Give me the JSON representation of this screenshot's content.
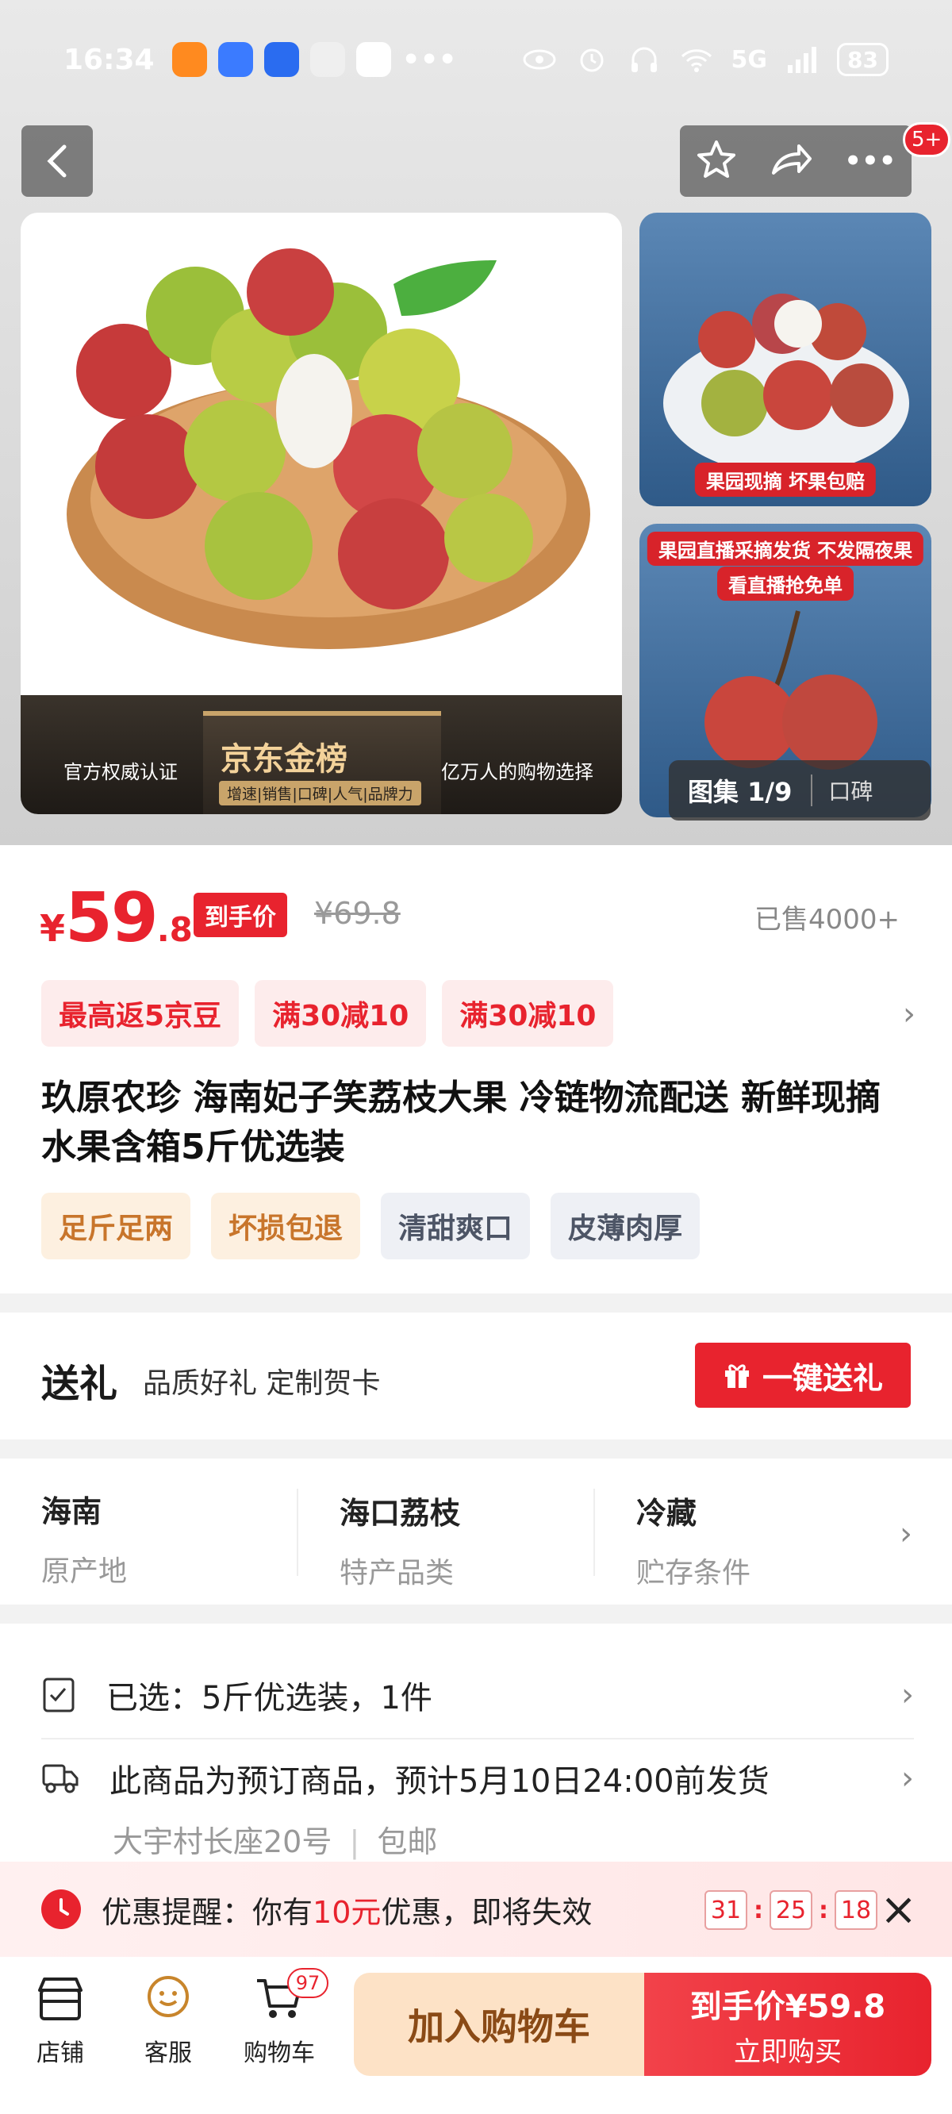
{
  "status_bar": {
    "time": "16:34",
    "network": "5G",
    "battery": "83",
    "overflow_dots": "•••"
  },
  "header": {
    "badge": "5+",
    "more_icon": "•••"
  },
  "gallery": {
    "main_banner_left": "官方权威认证",
    "main_banner_logo": "京东金榜",
    "main_banner_sub": "增速|销售|口碑|人气|品牌力",
    "main_banner_right": "亿万人的购物选择",
    "thumb1_tag": "果园现摘 坏果包赔",
    "thumb2_tag1": "果园直播采摘发货 不发隔夜果",
    "thumb2_tag2": "看直播抢免单",
    "count_label": "图集 1/9",
    "reviews_label": "口碑"
  },
  "price": {
    "currency": "¥",
    "integer": "59",
    "decimal": ".8",
    "after_tag": "到手价",
    "original": "¥69.8",
    "sold": "已售4000+"
  },
  "coupons": [
    "最高返5京豆",
    "满30减10",
    "满30减10"
  ],
  "product": {
    "title": "玖原农珍 海南妃子笑荔枝大果 冷链物流配送 新鲜现摘水果含箱5斤优选装",
    "tags": [
      "足斤足两",
      "坏损包退",
      "清甜爽口",
      "皮薄肉厚"
    ]
  },
  "gift": {
    "title": "送礼",
    "subtitle": "品质好礼 定制贺卡",
    "button": "一键送礼"
  },
  "attributes": [
    {
      "value": "海南",
      "key": "原产地"
    },
    {
      "value": "海口荔枝",
      "key": "特产品类"
    },
    {
      "value": "冷藏",
      "key": "贮存条件"
    }
  ],
  "selection": {
    "selected": "已选：5斤优选装，1件",
    "shipping": "此商品为预订商品，预计5月10日24:00前发货",
    "address": "大宇村长座20号",
    "shipping_fee": "包邮"
  },
  "promo": {
    "prefix": "优惠提醒：你有",
    "amount": "10元",
    "suffix": "优惠，即将失效",
    "timer_h": "31",
    "timer_m": "25",
    "timer_s": "18"
  },
  "bottom_bar": {
    "shop": "店铺",
    "service": "客服",
    "cart": "购物车",
    "cart_count": "97",
    "add_to_cart": "加入购物车",
    "buy_price": "到手价¥59.8",
    "buy_now": "立即购买"
  },
  "colors": {
    "accent_red": "#e8232e",
    "warm_tag": "#c8752b",
    "cart_button": "#fde2c6"
  }
}
